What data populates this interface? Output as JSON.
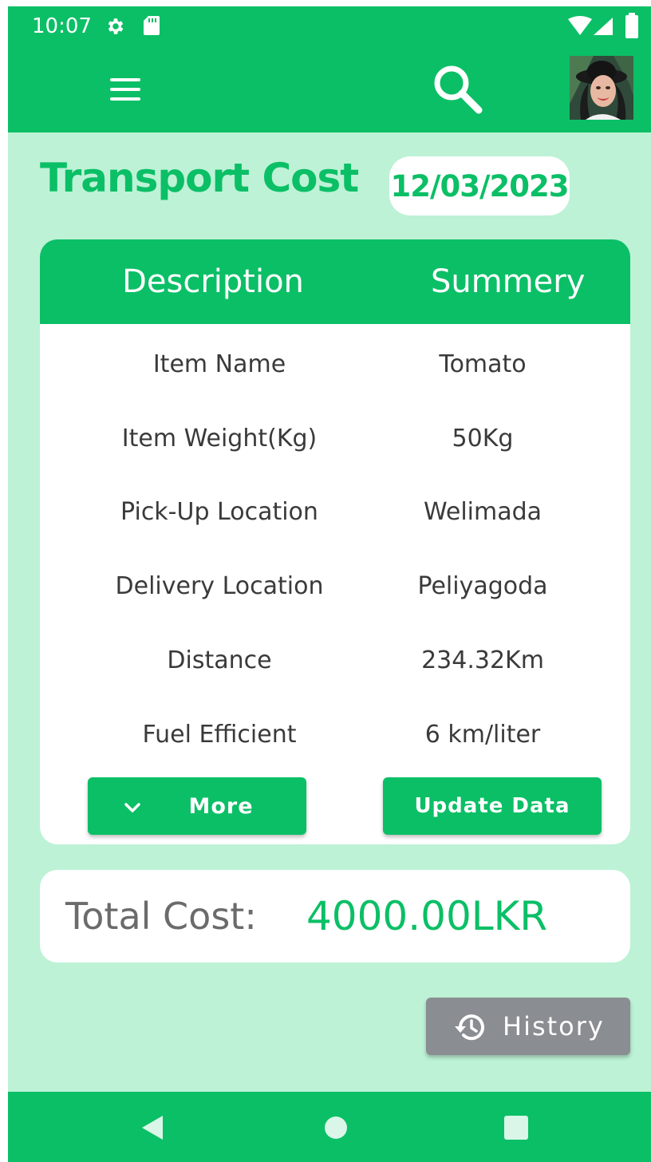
{
  "status_bar": {
    "time": "10:07",
    "icons": [
      "gear-icon",
      "sd-card-icon",
      "wifi-icon",
      "signal-icon",
      "battery-icon"
    ]
  },
  "app_bar": {
    "icons": [
      "menu-icon",
      "search-icon"
    ],
    "avatar": "user-avatar"
  },
  "page": {
    "title": "Transport Cost",
    "date": "12/03/2023"
  },
  "table": {
    "headers": {
      "description": "Description",
      "summary": "Summery"
    },
    "rows": [
      {
        "label": "Item Name",
        "value": "Tomato"
      },
      {
        "label": "Item Weight(Kg)",
        "value": "50Kg"
      },
      {
        "label": "Pick-Up Location",
        "value": "Welimada"
      },
      {
        "label": "Delivery Location",
        "value": "Peliyagoda"
      },
      {
        "label": "Distance",
        "value": "234.32Km"
      },
      {
        "label": "Fuel Efficient",
        "value": "6 km/liter"
      }
    ],
    "more_label": "More",
    "update_label": "Update Data"
  },
  "total": {
    "label": "Total Cost:",
    "value": "4000.00LKR"
  },
  "history": {
    "label": "History"
  },
  "colors": {
    "primary": "#0bbf66",
    "background": "#bdf2d6",
    "card": "#ffffff",
    "text": "#3a3a3a",
    "muted": "#6b6b6b",
    "history_button": "#8a8d91"
  }
}
